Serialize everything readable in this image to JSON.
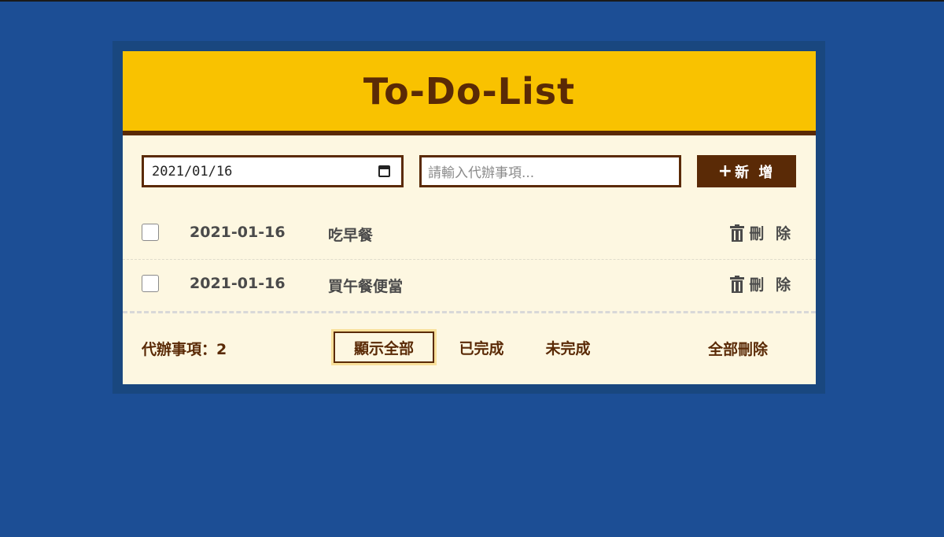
{
  "header": {
    "title": "To-Do-List"
  },
  "form": {
    "date_value": "2021/01/16",
    "todo_placeholder": "請輸入代辦事項...",
    "add_label": "新 增",
    "add_icon": "plus-icon"
  },
  "todos": [
    {
      "date": "2021-01-16",
      "text": "吃早餐",
      "done": false,
      "delete_label": "刪 除"
    },
    {
      "date": "2021-01-16",
      "text": "買午餐便當",
      "done": false,
      "delete_label": "刪 除"
    }
  ],
  "footer": {
    "count_label": "代辦事項：2",
    "filters": [
      "顯示全部",
      "已完成",
      "未完成"
    ],
    "active_filter": "顯示全部",
    "clear_all_label": "全部刪除"
  },
  "colors": {
    "background": "#1c4e95",
    "header": "#f9c200",
    "brown": "#5a2a06",
    "card": "#fdf7e1"
  }
}
